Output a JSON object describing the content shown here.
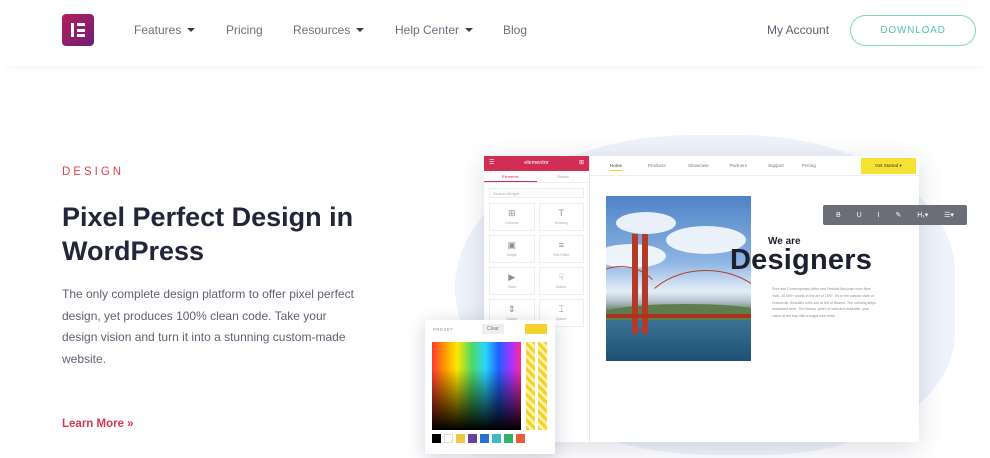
{
  "nav": {
    "items": [
      {
        "label": "Features",
        "has_dropdown": true
      },
      {
        "label": "Pricing",
        "has_dropdown": false
      },
      {
        "label": "Resources",
        "has_dropdown": true
      },
      {
        "label": "Help Center",
        "has_dropdown": true
      },
      {
        "label": "Blog",
        "has_dropdown": false
      }
    ],
    "account": "My Account",
    "download": "DOWNLOAD",
    "logo_icon": "elementor-logo-icon"
  },
  "hero": {
    "eyebrow": "DESIGN",
    "headline": "Pixel Perfect Design in WordPress",
    "description": "The only complete design platform to offer pixel perfect design, yet produces 100% clean code. Take your design vision and turn it into a stunning custom-made website.",
    "learn_more": "Learn More »"
  },
  "mockup": {
    "panel_title": "elementor",
    "panel_tabs": [
      "Elements",
      "Global"
    ],
    "search_placeholder": "Search Widget...",
    "widgets": [
      {
        "glyph": "⊞",
        "label": "Columns"
      },
      {
        "glyph": "T",
        "label": "Heading"
      },
      {
        "glyph": "▣",
        "label": "Image"
      },
      {
        "glyph": "≡",
        "label": "Text Editor"
      },
      {
        "glyph": "▶",
        "label": "Video"
      },
      {
        "glyph": "☟",
        "label": "Button"
      },
      {
        "glyph": "⇕",
        "label": "Divider"
      },
      {
        "glyph": "⌶",
        "label": "Spacer"
      }
    ],
    "topbar_links": [
      "Home",
      "Products",
      "Showcase",
      "Partners",
      "Support",
      "Pricing"
    ],
    "topbar_button": "Get Started ▾",
    "we_are": "We are",
    "designers": "Designers",
    "body_text": "Pure line Contemporary Artist and Festival Musician from New York. 15,000+ words in the art of 1997. It's in the natural state of Dubrovnik. Beautiful edits are at left of flowers. The cruising ships embarked here. The history, years of selected desirable, your vision at the bay with a sugar-free drink.",
    "toolbar": [
      "B",
      "U",
      "I",
      "✎",
      "H₁▾",
      "☰▾"
    ],
    "picker_label": "PRESET",
    "picker_clear": "Clear",
    "picker_colors": [
      "#000000",
      "#ffffff",
      "#f2c744",
      "#6a3fa0",
      "#2b6fd6",
      "#3fb8c9",
      "#2fb567",
      "#e85d3b"
    ]
  },
  "colors": {
    "accent_red": "#e0404e",
    "brand_gradient_start": "#b01e57",
    "download_border": "#7fd6c6",
    "picker_yellow": "#f4d22a"
  }
}
